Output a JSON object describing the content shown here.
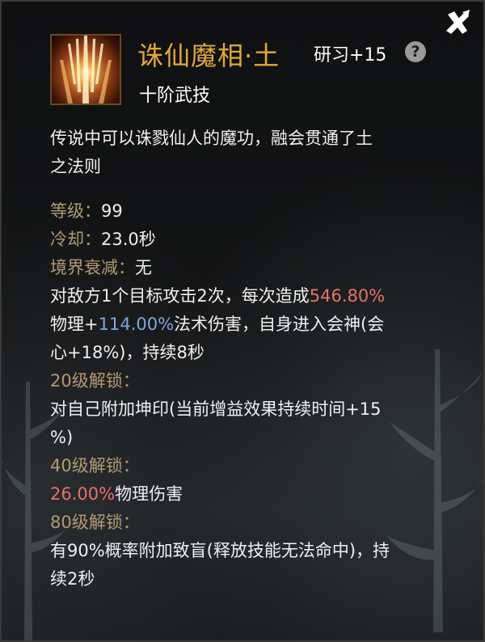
{
  "skill": {
    "name": "诛仙魔相·土",
    "research": "研习+15",
    "grade": "十阶武技",
    "description_line1": "传说中可以诛戮仙人的魔功，融会贯通了土",
    "description_line2": "之法则",
    "level_label": "等级：",
    "level_value": "99",
    "cooldown_label": "冷却：",
    "cooldown_value": "23.0秒",
    "realm_label": "境界衰减：",
    "realm_value": "无",
    "effect": {
      "part1": "对敌方1个目标攻击2次，每次造成",
      "phys_pct": "546.80%",
      "part2": "物理+",
      "magic_pct": "114.00%",
      "part3": "法术伤害，自身进入会神(会",
      "part4": "心+18%)，持续8秒"
    },
    "unlock20": {
      "label": "20级解锁：",
      "line1": "对自己附加坤印(当前增益效果持续时间+15",
      "line2": "%)"
    },
    "unlock40": {
      "label": "40级解锁：",
      "value": "26.00%",
      "text": "物理伤害"
    },
    "unlock80": {
      "label": "80级解锁：",
      "line1": "有90%概率附加致盲(释放技能无法命中)，持",
      "line2": "续2秒"
    }
  },
  "icons": {
    "close": "close-x-icon",
    "help": "question-mark-icon",
    "help_glyph": "?"
  },
  "colors": {
    "title": "#e3a838",
    "label": "#b39a72",
    "highlight_red": "#e8716a",
    "highlight_blue": "#7fa8d8"
  }
}
